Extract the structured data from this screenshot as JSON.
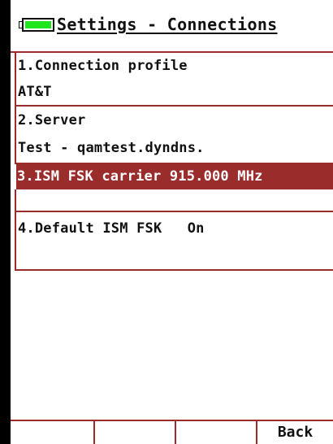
{
  "header": {
    "battery_icon": "battery-icon",
    "battery_color": "#1ee51e",
    "title": "Settings - Connections"
  },
  "colors": {
    "accent": "#9b2c2c"
  },
  "items": [
    {
      "label": "1.Connection profile",
      "value": "AT&T"
    },
    {
      "label": "2.Server",
      "value": "Test - qamtest.dyndns."
    },
    {
      "label": "3.ISM FSK carrier 915.000 MHz",
      "selected": true
    },
    {
      "label": "4.Default ISM FSK   On"
    }
  ],
  "softkeys": [
    "",
    "",
    "",
    "Back"
  ]
}
